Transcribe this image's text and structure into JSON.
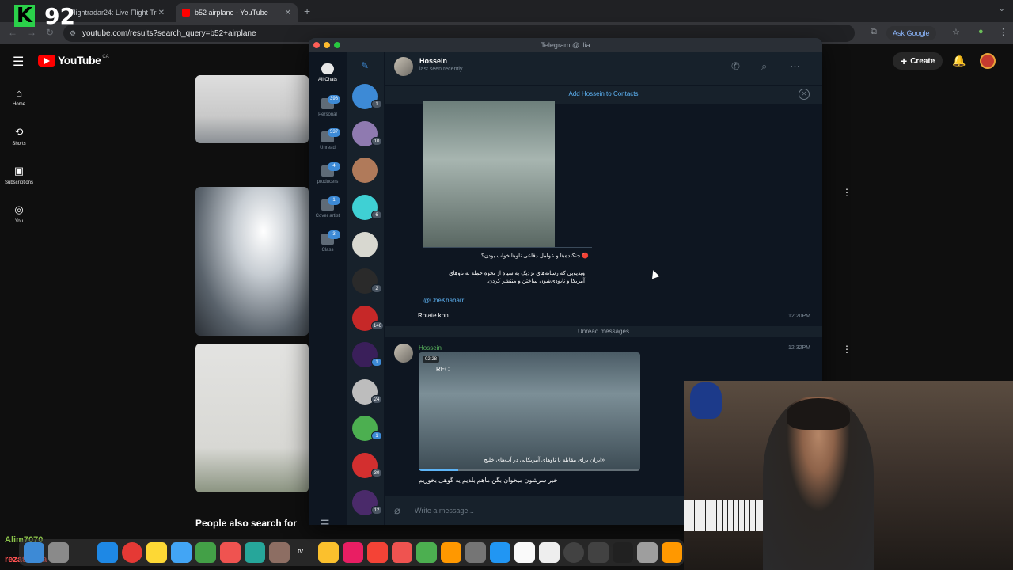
{
  "browser": {
    "tabs": [
      {
        "title": "Flightradar24: Live Flight Tra",
        "active": false
      },
      {
        "title": "b52 airplane - YouTube",
        "active": true
      }
    ],
    "url": "youtube.com/results?search_query=b52+airplane",
    "ask_google": "Ask Google"
  },
  "overlay": {
    "logo_letter": "K",
    "logo_number": "92",
    "user_tag_1": "Alim7070",
    "user_tag_2": "reza913ba"
  },
  "youtube": {
    "logo_text": "YouTube",
    "country": "CA",
    "create_label": "Create",
    "sidebar": [
      {
        "label": "Home",
        "icon": "home-icon"
      },
      {
        "label": "Shorts",
        "icon": "shorts-icon"
      },
      {
        "label": "Subscriptions",
        "icon": "subscriptions-icon"
      },
      {
        "label": "You",
        "icon": "you-icon"
      }
    ],
    "people_also_search": "People also search for"
  },
  "telegram": {
    "window_title": "Telegram @ ilia",
    "folders": [
      {
        "label": "All Chats",
        "badge": ""
      },
      {
        "label": "Personal",
        "badge": "396"
      },
      {
        "label": "Unread",
        "badge": "537"
      },
      {
        "label": "producers",
        "badge": "4"
      },
      {
        "label": "Cover artist",
        "badge": "1"
      },
      {
        "label": "Class",
        "badge": "3"
      }
    ],
    "chat_badges": [
      "1",
      "10",
      "",
      "6",
      "",
      "2",
      "146",
      "1",
      "24",
      "1",
      "30",
      "12"
    ],
    "peer": {
      "name": "Hossein",
      "status": "last seen recently"
    },
    "add_contact": "Add Hossein to Contacts",
    "messages": {
      "caption_line1": "🔴 جنگنده‌ها و عوامل دفاعی ناوها خواب بودن؟",
      "caption_line2": "ویدیویی که رسانه‌های نزدیک به سپاه از نحوه حمله به ناوهای",
      "caption_line3": "آمریکا و نابودی‌شون ساختن و منتشر کردن.",
      "caption_link": "@CheKhabarr",
      "reply_text": "Rotate kon",
      "reply_time": "12:20PM",
      "unread_label": "Unread messages",
      "sender": "Hossein",
      "video_time": "12:32PM",
      "video_duration": "02:28",
      "video_rec": "REC",
      "video_caption": "«ایران برای مقابله با ناوهای آمریکایی در آب‌های خلیج",
      "video_progress": 0.18,
      "followup_text": "خیر سرشون میخوان بگن ماهم بلدیم یه گوهی بخوریم"
    },
    "composer_placeholder": "Write a message..."
  },
  "dock": {
    "tv_label": "tv"
  }
}
